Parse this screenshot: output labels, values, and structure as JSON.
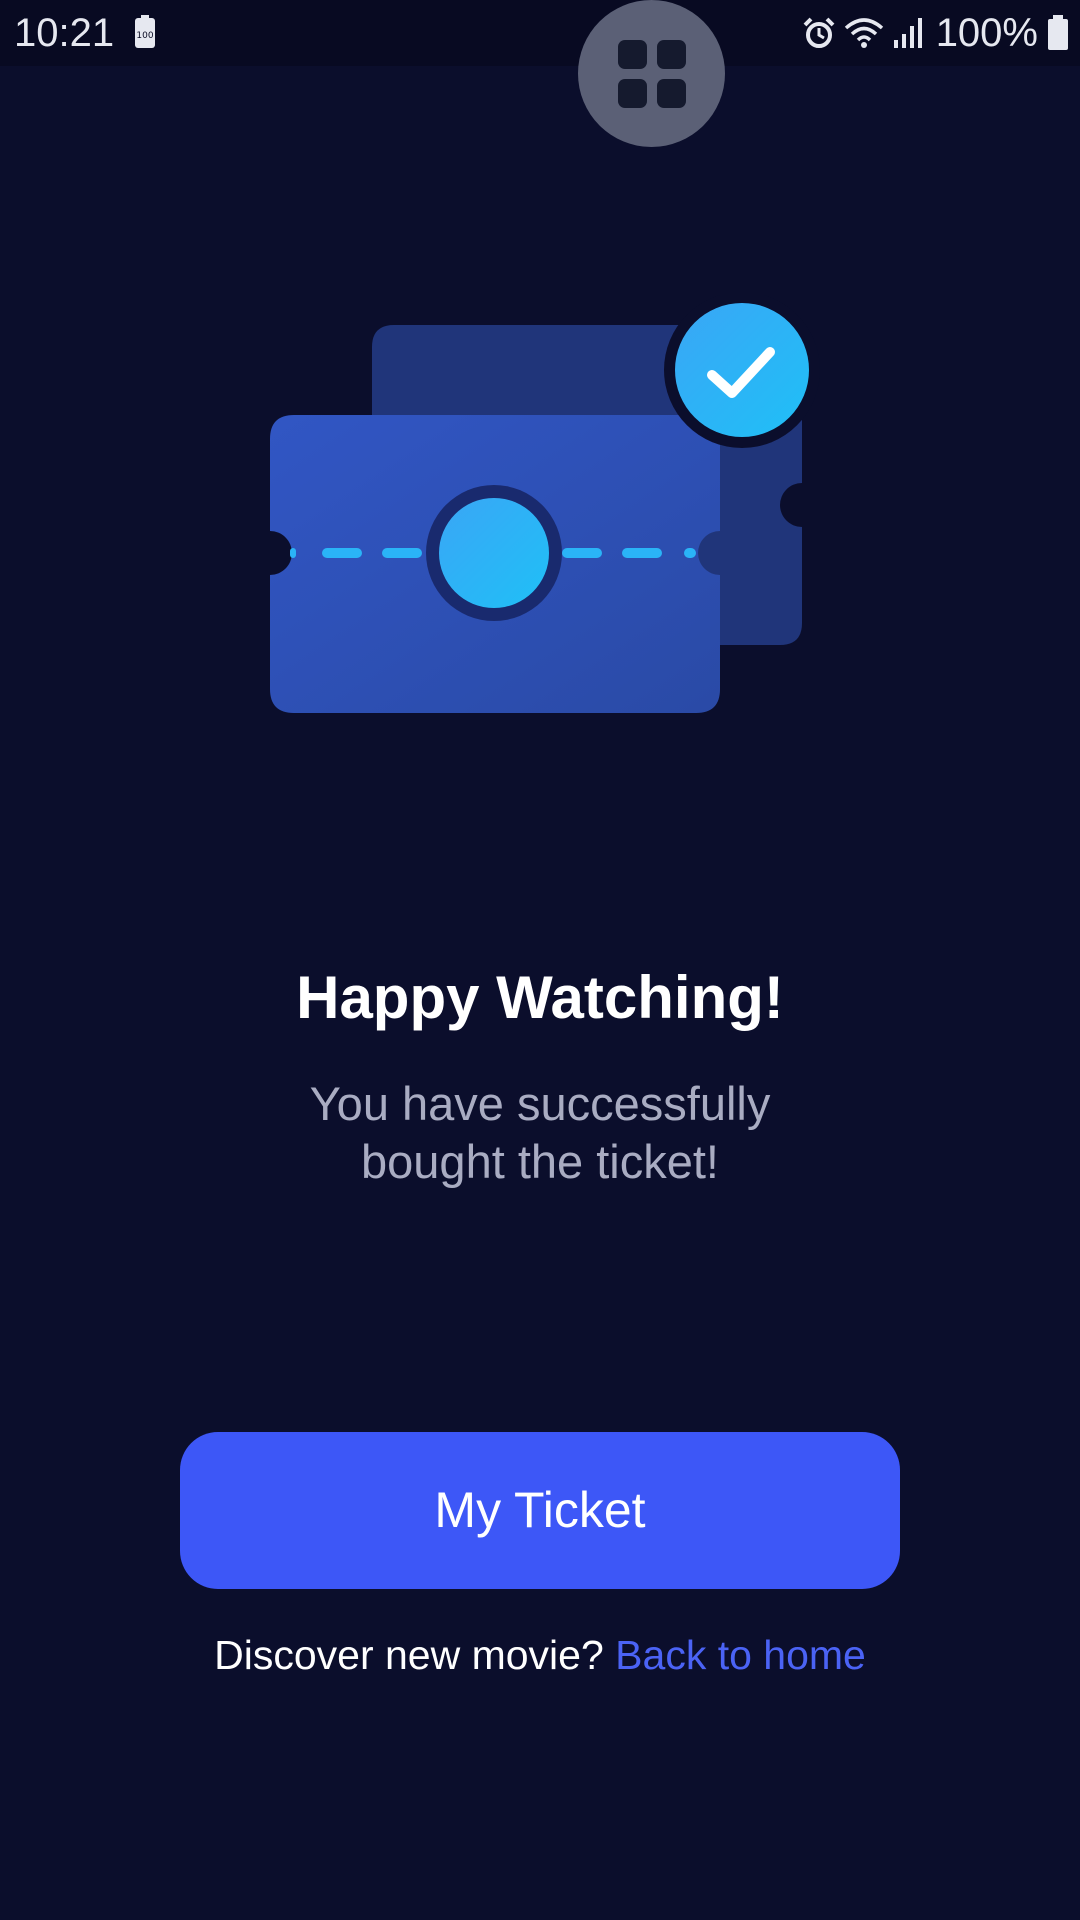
{
  "status_bar": {
    "time": "10:21",
    "battery_percent": "100%",
    "icons": [
      "battery-saver-icon",
      "alarm-icon",
      "wifi-icon",
      "signal-icon",
      "battery-icon"
    ]
  },
  "floating_button": {
    "icon": "grid-icon"
  },
  "illustration": {
    "icons": [
      "ticket-icon",
      "checkmark-badge-icon"
    ],
    "colors": {
      "ticket_front": "#2f52b8",
      "ticket_back": "#20357a",
      "accent_circle": "#2ab4f7",
      "check_badge": "#2aaaf6"
    }
  },
  "content": {
    "title": "Happy Watching!",
    "subtitle": "You have successfully bought the ticket!"
  },
  "primary_button": {
    "label": "My Ticket"
  },
  "footer": {
    "prompt": "Discover new movie?",
    "link_label": "Back to home"
  },
  "colors": {
    "background": "#0b0e2c",
    "accent": "#3d57f7",
    "link": "#4b63f5",
    "subtitle_text": "#a9acc2"
  }
}
